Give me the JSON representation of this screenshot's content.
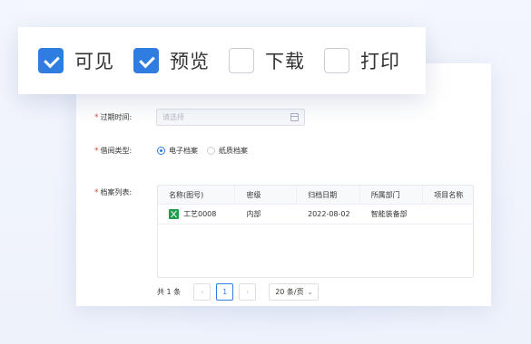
{
  "permissions": [
    {
      "label": "可见",
      "checked": true
    },
    {
      "label": "预览",
      "checked": true
    },
    {
      "label": "下载",
      "checked": false
    },
    {
      "label": "打印",
      "checked": false
    }
  ],
  "form": {
    "required_mark": "*",
    "expire_label": "过期时间:",
    "expire_placeholder": "请选择",
    "borrow_label": "借阅类型:",
    "borrow_options": [
      {
        "label": "电子档案",
        "selected": true
      },
      {
        "label": "纸质档案",
        "selected": false
      }
    ],
    "archive_label": "档案列表:"
  },
  "table": {
    "headers": [
      "名称(图号)",
      "密级",
      "归档日期",
      "所属部门",
      "项目名称"
    ],
    "rows": [
      {
        "name": "工艺0008",
        "secret": "内部",
        "date": "2022-08-02",
        "dept": "智能装备部",
        "project": ""
      }
    ]
  },
  "pagination": {
    "total": "共 1 条",
    "prev": "‹",
    "current": "1",
    "next": "›",
    "page_size": "20 条/页"
  },
  "colors": {
    "accent": "#2f7de1",
    "required": "#e04a3a",
    "excel": "#1f9e4a"
  }
}
